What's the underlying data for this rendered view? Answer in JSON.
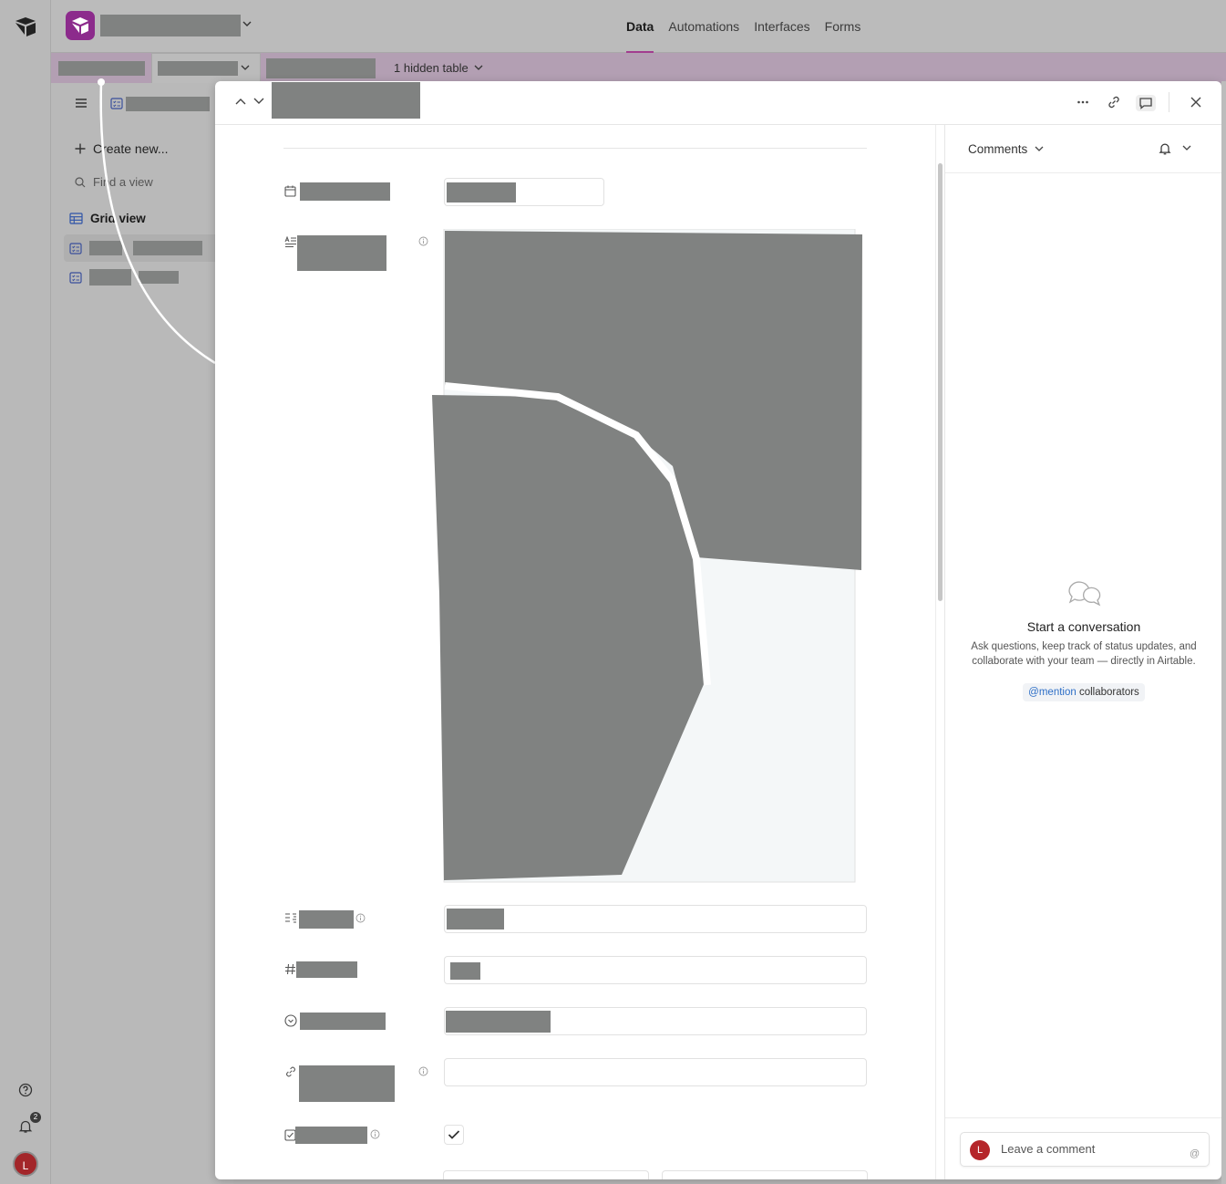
{
  "topbar": {
    "nav": [
      {
        "label": "Data",
        "active": true
      },
      {
        "label": "Automations",
        "active": false
      },
      {
        "label": "Interfaces",
        "active": false
      },
      {
        "label": "Forms",
        "active": false
      }
    ]
  },
  "tables": {
    "hidden_label": "1 hidden table"
  },
  "sidebar": {
    "create_label": "Create new...",
    "find_placeholder": "Find a view",
    "grid_view_label": "Grid view"
  },
  "rail": {
    "notification_count": "2",
    "avatar_initial": "L"
  },
  "comments": {
    "header_label": "Comments",
    "empty_title": "Start a conversation",
    "empty_text": "Ask questions, keep track of status updates, and collaborate with your team — directly in Airtable.",
    "mention_at": "@mention",
    "mention_rest": " collaborators",
    "input_placeholder": "Leave a comment",
    "avatar_initial": "L",
    "at_symbol": "@"
  },
  "colors": {
    "accent": "#a23c8f",
    "app_icon": "#8c2b8c",
    "avatar": "#b5262a",
    "redaction": "#808281",
    "link": "#2e6fc7"
  },
  "icons": [
    "airtable-logo-icon",
    "help-icon",
    "bell-icon",
    "chevron-down-icon",
    "chevron-up-icon",
    "menu-icon",
    "form-view-icon",
    "plus-icon",
    "search-icon",
    "grid-view-icon",
    "calendar-icon",
    "long-text-icon",
    "info-icon",
    "multi-select-icon",
    "number-icon",
    "single-select-icon",
    "link-icon",
    "checkbox-icon",
    "check-icon",
    "more-icon",
    "comment-icon",
    "close-icon",
    "speech-bubbles-icon"
  ]
}
